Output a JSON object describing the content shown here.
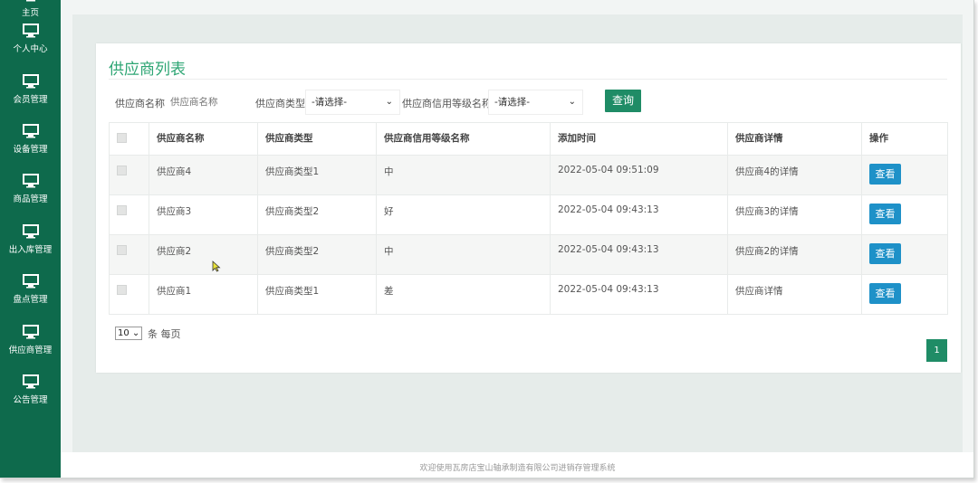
{
  "sidebar": {
    "items": [
      {
        "label": "主页",
        "icon": "monitor-icon"
      },
      {
        "label": "个人中心",
        "icon": "monitor-icon"
      },
      {
        "label": "会员管理",
        "icon": "monitor-icon"
      },
      {
        "label": "设备管理",
        "icon": "monitor-icon"
      },
      {
        "label": "商品管理",
        "icon": "monitor-icon"
      },
      {
        "label": "出入库管理",
        "icon": "monitor-icon"
      },
      {
        "label": "盘点管理",
        "icon": "monitor-icon"
      },
      {
        "label": "供应商管理",
        "icon": "monitor-icon"
      },
      {
        "label": "公告管理",
        "icon": "monitor-icon"
      }
    ]
  },
  "page": {
    "title": "供应商列表"
  },
  "filters": {
    "name_label": "供应商名称",
    "name_placeholder": "供应商名称",
    "type_label": "供应商类型",
    "type_value": "-请选择-",
    "credit_label": "供应商信用等级名称",
    "credit_value": "-请选择-",
    "query_label": "查询"
  },
  "table": {
    "headers": [
      "供应商名称",
      "供应商类型",
      "供应商信用等级名称",
      "添加时间",
      "供应商详情",
      "操作"
    ],
    "view_label": "查看",
    "rows": [
      {
        "name": "供应商4",
        "type": "供应商类型1",
        "credit": "中",
        "time": "2022-05-04 09:51:09",
        "detail": "供应商4的详情"
      },
      {
        "name": "供应商3",
        "type": "供应商类型2",
        "credit": "好",
        "time": "2022-05-04 09:43:13",
        "detail": "供应商3的详情"
      },
      {
        "name": "供应商2",
        "type": "供应商类型2",
        "credit": "中",
        "time": "2022-05-04 09:43:13",
        "detail": "供应商2的详情"
      },
      {
        "name": "供应商1",
        "type": "供应商类型1",
        "credit": "差",
        "time": "2022-05-04 09:43:13",
        "detail": "供应商详情"
      }
    ]
  },
  "pagination": {
    "page_size": "10",
    "page_size_suffix": "条 每页",
    "current_page": "1"
  },
  "footer": {
    "text": "欢迎使用瓦房店宝山轴承制造有限公司进销存管理系统"
  },
  "colors": {
    "sidebar": "#0e6a4c",
    "title": "#2ea674",
    "primary_button": "#1f8c66",
    "view_button": "#1e91c8"
  }
}
